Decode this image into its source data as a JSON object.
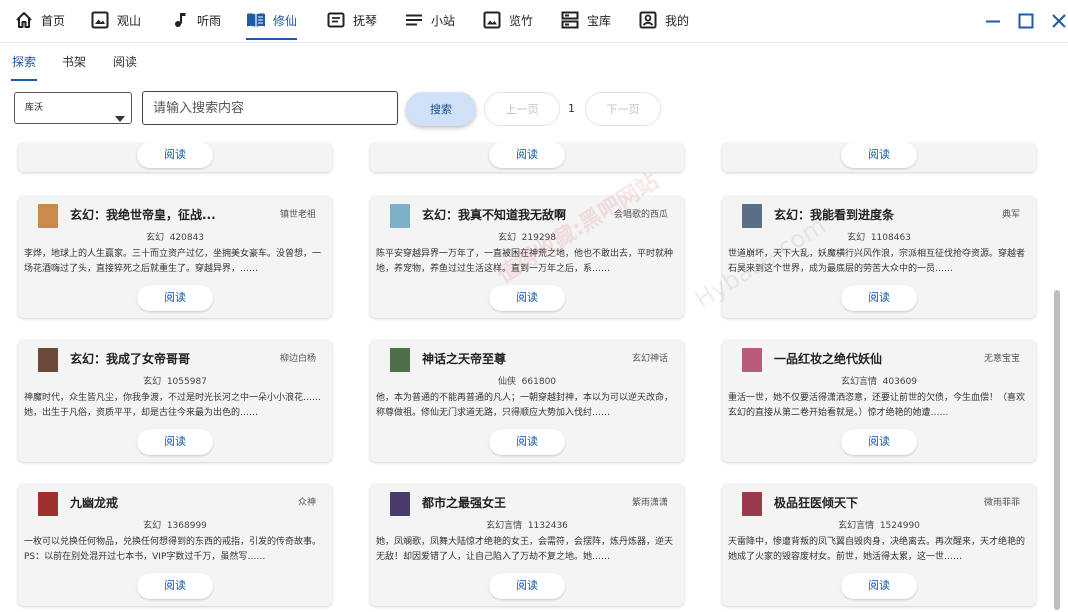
{
  "nav": {
    "items": [
      {
        "label": "首页",
        "icon": "home-icon"
      },
      {
        "label": "观山",
        "icon": "landscape-icon"
      },
      {
        "label": "听雨",
        "icon": "music-note-icon"
      },
      {
        "label": "修仙",
        "icon": "book-icon"
      },
      {
        "label": "抚琴",
        "icon": "article-icon"
      },
      {
        "label": "小站",
        "icon": "menu-lines-icon"
      },
      {
        "label": "览竹",
        "icon": "image-icon"
      },
      {
        "label": "宝库",
        "icon": "storage-icon"
      },
      {
        "label": "我的",
        "icon": "account-icon"
      }
    ],
    "active_index": 3,
    "accent": "#1d5aa8"
  },
  "subtabs": {
    "items": [
      "探索",
      "书架",
      "阅读"
    ],
    "active_index": 0
  },
  "search": {
    "source_value": "库沃",
    "placeholder": "请输入搜索内容",
    "search_label": "搜索",
    "prev_label": "上一页",
    "page": "1",
    "next_label": "下一页"
  },
  "read_label": "阅读",
  "books": [
    {
      "title": "玄幻：我绝世帝皇，征战...",
      "author": "镇世老祖",
      "meta": "玄幻  420843",
      "desc": "李烨，地球上的人生赢家。三十而立资产过亿，坐拥美女豪车。没曾想，一场花酒嗨过了头，直接猝死之后就重生了。穿越异界，……",
      "cover": "#c98a4a"
    },
    {
      "title": "玄幻：我真不知道我无敌啊",
      "author": "会唱歌的西瓜",
      "meta": "玄幻  219298",
      "desc": "陈平安穿越异界一万年了，一直被困在神荒之地，他也不敢出去，平时就种地，养宠物，养鱼过过生活这样。直到一万年之后，系……",
      "cover": "#7bb0c7"
    },
    {
      "title": "玄幻：我能看到进度条",
      "author": "典军",
      "meta": "玄幻  1108463",
      "desc": "世道崩坏，天下大乱，妖魔横行兴风作浪，宗派相互征伐抢夺资源。穿越者石昊来到这个世界，成为最底层的劳苦大众中的一员……",
      "cover": "#5a6f86"
    },
    {
      "title": "玄幻：我成了女帝哥哥",
      "author": "柳边白杨",
      "meta": "玄幻  1055987",
      "desc": "神魔时代，众生皆凡尘，你我争渡，不过是时光长河之中一朵小小浪花……她，出生于凡俗，资质平平，却是古往今来最为出色的……",
      "cover": "#6a4a3a"
    },
    {
      "title": "神话之天帝至尊",
      "author": "玄幻神话",
      "meta": "仙侠  661800",
      "desc": "他，本为普通的不能再普通的凡人；一朝穿越封神，本以为可以逆天改命，称尊做祖。修仙无门求道无路，只得顺应大势加入伐纣……",
      "cover": "#4f6e4a"
    },
    {
      "title": "一品红妆之绝代妖仙",
      "author": "无意宝宝",
      "meta": "玄幻言情  403609",
      "desc": "重活一世，她不仅要活得潇洒恣意，还要让前世的欠债，今生血偿！（喜欢玄幻的直接从第二卷开始看就是。）惊才绝艳的她遭……",
      "cover": "#b85a78"
    },
    {
      "title": "九幽龙戒",
      "author": "众神",
      "meta": "玄幻  1368999",
      "desc": "一枚可以兑换任何物品，兑换任何想得到的东西的戒指，引发的传奇故事。PS：以前在别处混开过七本书，VIP字数过千万，虽然写……",
      "cover": "#a0302e"
    },
    {
      "title": "都市之最强女王",
      "author": "紫雨潇潇",
      "meta": "玄幻言情  1132436",
      "desc": "她，凤斓歌，凤舞大陆惊才绝艳的女王，会需符，会摆阵，炼丹炼器，逆天无敌！却因爱错了人，让自己陷入了万劫不复之地。她……",
      "cover": "#4a3a6a"
    },
    {
      "title": "极品狂医倾天下",
      "author": "微雨菲菲",
      "meta": "玄幻言情  1524990",
      "desc": "天雷降中，惨遭背叛的凤飞翼自毁肉身，决绝离去。再次醒来，天才绝艳的她成了火家的毁容废材女。前世，她活得太累，这一世……",
      "cover": "#9a3a4a"
    }
  ],
  "watermark": {
    "text_red": "值得收藏:黑吧网站",
    "text_gray": "Hybase.com"
  }
}
